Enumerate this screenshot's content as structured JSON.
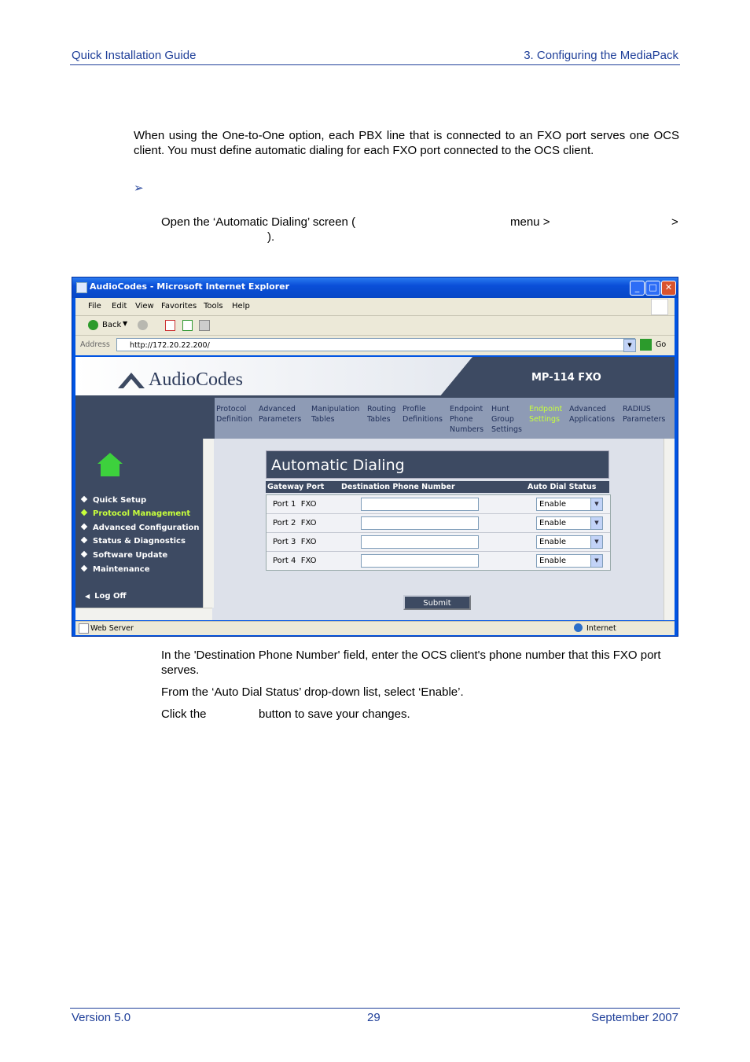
{
  "page_header": {
    "left": "Quick Installation Guide",
    "right": "3. Configuring the MediaPack"
  },
  "intro_text": "When using the One-to-One option, each PBX line that is connected to an FXO port serves one OCS client. You must define automatic dialing for each FXO port connected to the OCS client.",
  "procedure_bullet": "➢",
  "step1": {
    "part1": "Open the ‘Automatic Dialing’ screen (",
    "part2": "menu >",
    "part3": ">",
    "part4": ")."
  },
  "browser": {
    "title": "AudioCodes - Microsoft Internet Explorer",
    "menu": [
      "File",
      "Edit",
      "View",
      "Favorites",
      "Tools",
      "Help"
    ],
    "back_label": "Back",
    "address_label": "Address",
    "address": "http://172.20.22.200/",
    "go_label": "Go",
    "status_left": "Web Server",
    "status_right": "Internet"
  },
  "app": {
    "brand": "AudioCodes",
    "device": "MP-114 FXO",
    "nav": [
      {
        "label": "Protocol\nDefinition"
      },
      {
        "label": "Advanced\nParameters"
      },
      {
        "label": "Manipulation\nTables"
      },
      {
        "label": "Routing\nTables"
      },
      {
        "label": "Profile\nDefinitions"
      },
      {
        "label": "Endpoint\nPhone\nNumbers"
      },
      {
        "label": "Hunt\nGroup\nSettings"
      },
      {
        "label": "Endpoint\nSettings"
      },
      {
        "label": "Advanced\nApplications"
      },
      {
        "label": "RADIUS\nParameters"
      }
    ],
    "side_menu": [
      "Quick Setup",
      "Protocol Management",
      "Advanced Configuration",
      "Status & Diagnostics",
      "Software Update",
      "Maintenance"
    ],
    "logoff": "Log Off",
    "screen_title": "Automatic Dialing",
    "columns": [
      "Gateway Port",
      "Destination Phone Number",
      "Auto Dial Status"
    ],
    "rows": [
      {
        "port": "Port 1  FXO",
        "number": "",
        "status": "Enable"
      },
      {
        "port": "Port 2  FXO",
        "number": "",
        "status": "Enable"
      },
      {
        "port": "Port 3  FXO",
        "number": "",
        "status": "Enable"
      },
      {
        "port": "Port 4  FXO",
        "number": "",
        "status": "Enable"
      }
    ],
    "submit": "Submit"
  },
  "step2": "In the 'Destination Phone Number' field, enter the OCS client's phone number that this FXO port serves.",
  "step3": "From the ‘Auto Dial Status’ drop-down list, select ‘Enable’.",
  "step4": {
    "part1": "Click the",
    "part2": "button to save your changes."
  },
  "footer": {
    "left": "Version 5.0",
    "center": "29",
    "right": "September 2007"
  }
}
